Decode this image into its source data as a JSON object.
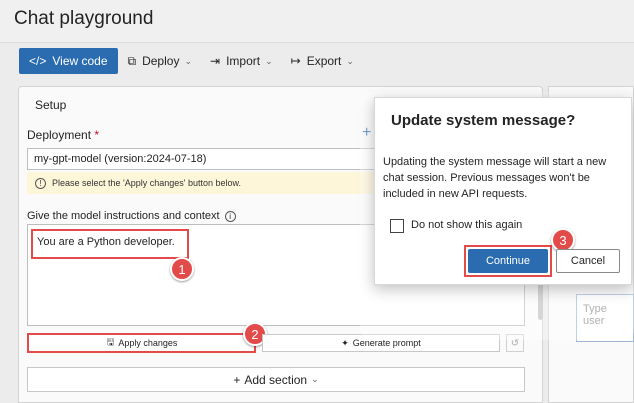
{
  "page": {
    "title": "Chat playground"
  },
  "toolbar": {
    "view_code": "View code",
    "deploy": "Deploy",
    "import": "Import",
    "export": "Export"
  },
  "setup": {
    "heading": "Setup",
    "deployment_label": "Deployment",
    "required_mark": "*",
    "deployment_value": "my-gpt-model (version:2024-07-18)",
    "warning": "Please select the 'Apply changes' button below.",
    "instructions_label": "Give the model instructions and context",
    "instructions_value": "You are a Python developer.",
    "apply_changes": "Apply changes",
    "generate_prompt": "Generate prompt",
    "add_section": "Add section"
  },
  "chat": {
    "input_placeholder": "Type user"
  },
  "dialog": {
    "title": "Update system message?",
    "body": "Updating the system message will start a new chat session. Previous messages won't be included in new API requests.",
    "checkbox_label": "Do not show this again",
    "continue": "Continue",
    "cancel": "Cancel"
  },
  "callouts": {
    "step1": "1",
    "step2": "2",
    "step3": "3"
  },
  "colors": {
    "accent": "#2b6cb0",
    "callout": "#e34b4b",
    "warning_bg": "#fdf6d8"
  }
}
